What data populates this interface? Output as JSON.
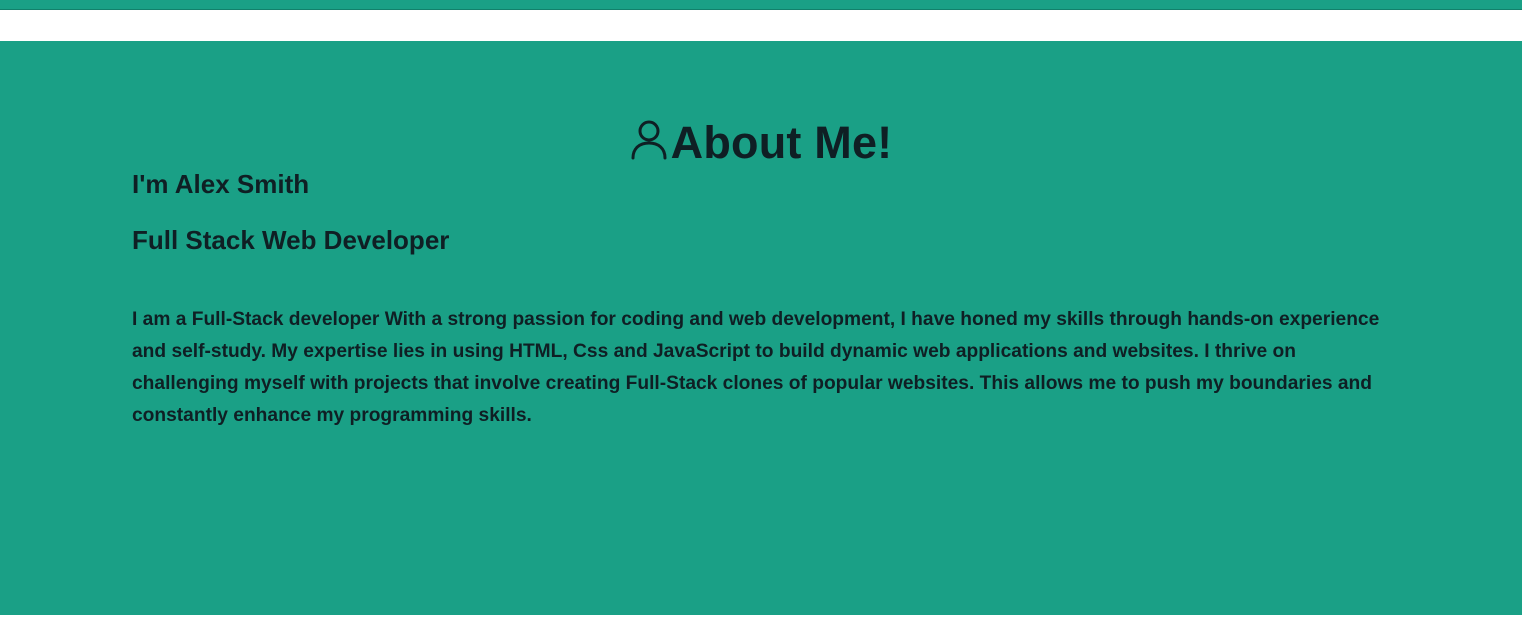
{
  "about": {
    "heading": "About Me!",
    "heading_icon": "user-icon",
    "name_line": "I'm Alex Smith",
    "role_line": "Full Stack Web Developer",
    "bio": "I am a Full-Stack developer With a strong passion for coding and web development, I have honed my skills through hands-on experience and self-study. My expertise lies in using HTML, Css and JavaScript to build dynamic web applications and websites. I thrive on challenging myself with projects that involve creating Full-Stack clones of popular websites. This allows me to push my boundaries and constantly enhance my programming skills."
  },
  "colors": {
    "section_background": "#1aa086",
    "text": "#0f1f24",
    "page_background": "#ffffff"
  }
}
